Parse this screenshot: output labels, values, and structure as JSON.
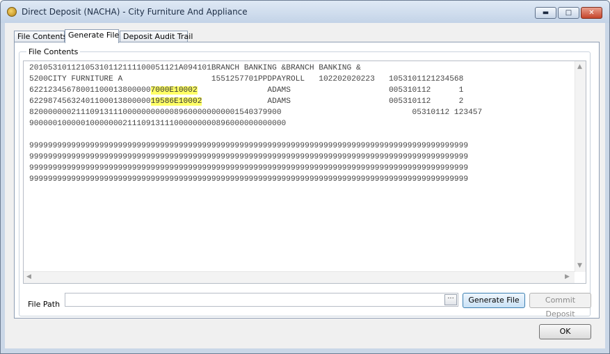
{
  "window": {
    "title": "Direct Deposit (NACHA) - City Furniture And Appliance",
    "minimize_glyph": "▬",
    "maximize_glyph": "□",
    "close_glyph": "✕"
  },
  "tabs": [
    {
      "label": "File Contents"
    },
    {
      "label": "Generate File"
    },
    {
      "label": "Deposit Audit Trail"
    }
  ],
  "active_tab": "Generate File",
  "group": {
    "legend": "File Contents"
  },
  "file_lines": [
    {
      "text": "20105310112105310112111100051121A094101BRANCH BANKING &BRANCH BANKING &"
    },
    {
      "text": "5200CITY FURNITURE A                   1551257701PPDPAYROLL   102202020223   1053101121234568"
    },
    {
      "pre": "62212345678001100013800000",
      "hl": "7000E10002",
      "post": "               ADAMS                     005310112      1"
    },
    {
      "pre": "62298745632401100013800000",
      "hl": "19586E10002",
      "post": "              ADAMS                     005310112      2"
    },
    {
      "text": "820000000211109131110000000000089600000000001540379900                            05310112 123457"
    },
    {
      "text": "9000001000001000000021110913111000000000896000000000000"
    },
    {
      "text": ""
    },
    {
      "text": "9999999999999999999999999999999999999999999999999999999999999999999999999999999999999999999999"
    },
    {
      "text": "9999999999999999999999999999999999999999999999999999999999999999999999999999999999999999999999"
    },
    {
      "text": "9999999999999999999999999999999999999999999999999999999999999999999999999999999999999999999999"
    },
    {
      "text": "9999999999999999999999999999999999999999999999999999999999999999999999999999999999999999999999"
    }
  ],
  "file_path": {
    "label": "File Path",
    "value": "",
    "browse_label": "···"
  },
  "buttons": {
    "generate": "Generate File",
    "commit": "Commit Deposit",
    "ok": "OK"
  },
  "icons": {
    "scroll_up": "▲",
    "scroll_down": "▼",
    "scroll_left": "◀",
    "scroll_right": "▶"
  }
}
